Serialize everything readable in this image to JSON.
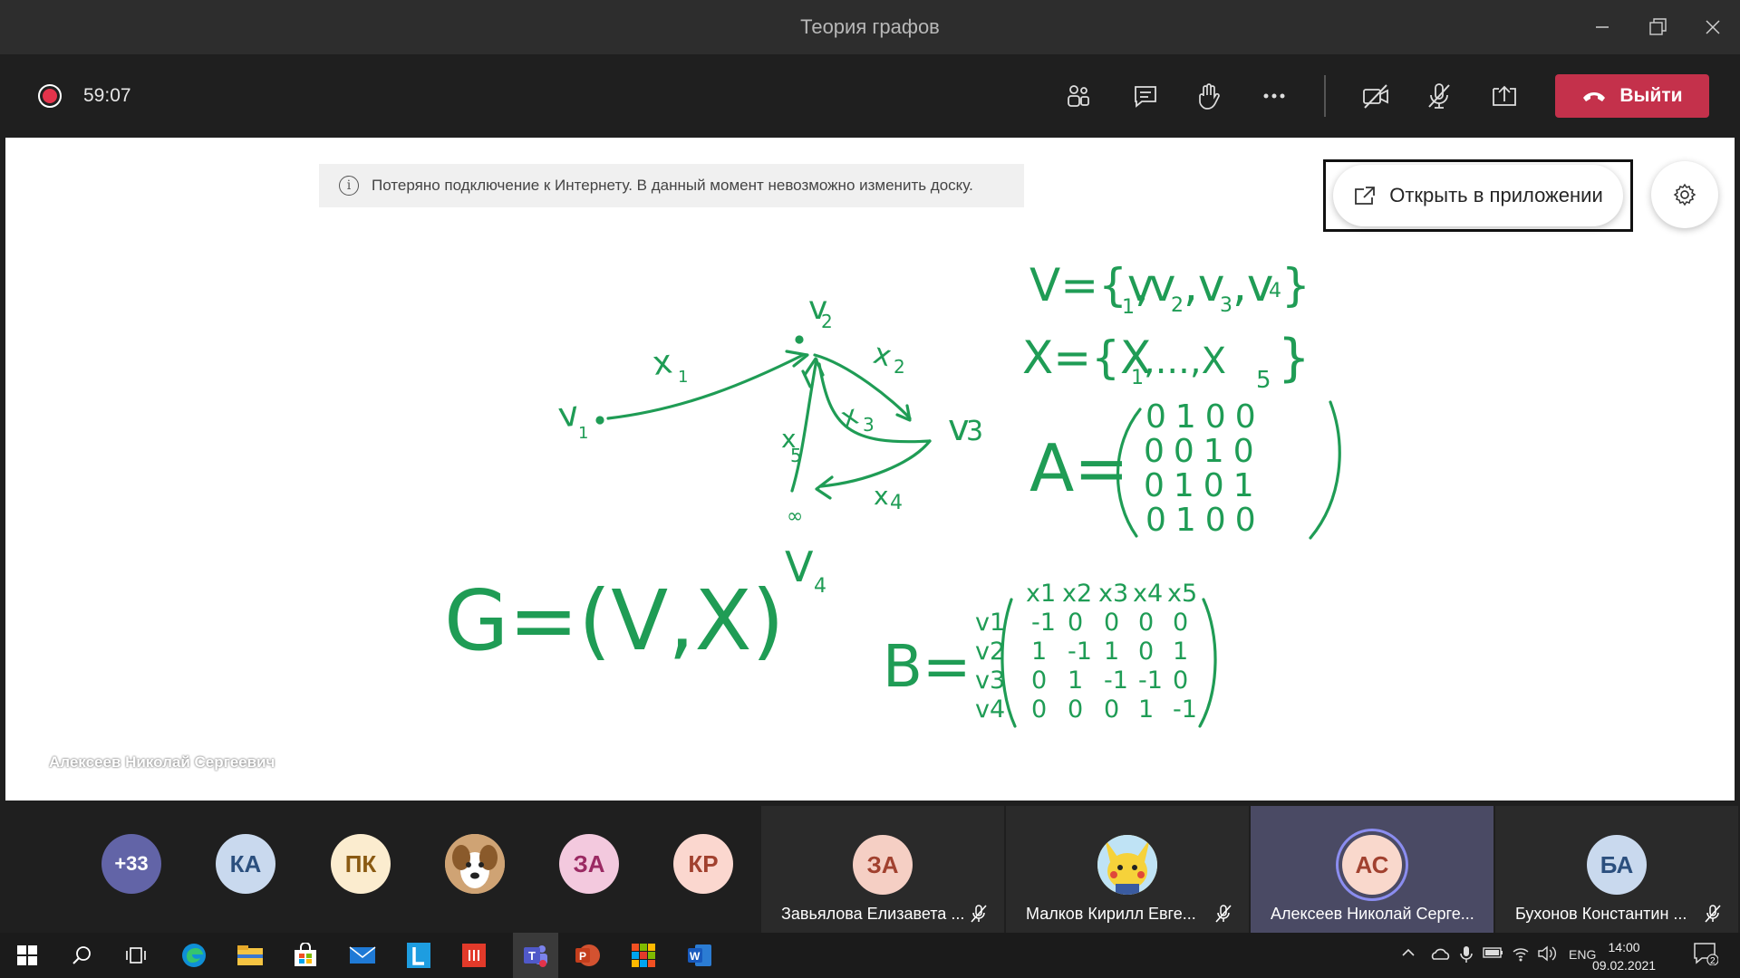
{
  "window": {
    "title": "Теория графов"
  },
  "toolbar": {
    "timer": "59:07",
    "leave_label": "Выйти",
    "buttons": [
      "participants-icon",
      "chat-icon",
      "raise-hand-icon",
      "more-icon",
      "camera-off-icon",
      "mic-off-icon",
      "share-tray-icon"
    ],
    "accent": "#c4314b"
  },
  "whiteboard": {
    "warning": "Потеряно подключение к Интернету. В данный момент невозможно изменить доску.",
    "open_in_app": "Открыть в приложении",
    "presenter": "Алексеев Николай Сергеевич",
    "ink_color": "#1f9c55",
    "matrix_b": {
      "col_headers": [
        "x1",
        "x2",
        "x3",
        "x4",
        "x5"
      ],
      "row_headers": [
        "v1",
        "v2",
        "v3",
        "v4"
      ],
      "rows": [
        [
          "-1",
          "0",
          "0",
          "0",
          "0"
        ],
        [
          "1",
          "-1",
          "1",
          "0",
          "1"
        ],
        [
          "0",
          "1",
          "-1",
          "-1",
          "0"
        ],
        [
          "0",
          "0",
          "0",
          "1",
          "-1"
        ]
      ]
    },
    "matrix_a": {
      "rows": [
        [
          "0",
          "1",
          "0",
          "0"
        ],
        [
          "0",
          "0",
          "1",
          "0"
        ],
        [
          "0",
          "1",
          "0",
          "1"
        ],
        [
          "0",
          "1",
          "0",
          "0"
        ]
      ]
    }
  },
  "participants": {
    "overflow": "+33",
    "small_avatars": [
      {
        "initials": "КА",
        "bg": "#c9d9ee",
        "fg": "#2b4f7e"
      },
      {
        "initials": "ПК",
        "bg": "#fbeccf",
        "fg": "#8a5a12"
      },
      {
        "initials": "",
        "bg": "#d8b48a",
        "fg": "#5a3a1a",
        "icon": "dog-photo"
      },
      {
        "initials": "ЗА",
        "bg": "#f3c9de",
        "fg": "#9b2a63"
      },
      {
        "initials": "КР",
        "bg": "#fbd7cf",
        "fg": "#a1412f"
      }
    ],
    "tiles": [
      {
        "initials": "ЗА",
        "name": "Завьялова Елизавета ...",
        "bg": "#f5cfc4",
        "fg": "#a1412f"
      },
      {
        "initials": "",
        "name": "Малков Кирилл Евге...",
        "bg": "#f3dd6b",
        "fg": "#444",
        "icon": "pikachu-photo"
      },
      {
        "initials": "АС",
        "name": "Алексеев Николай Серге...",
        "bg": "#f9d8cc",
        "fg": "#a1412f",
        "speaking": true
      },
      {
        "initials": "БА",
        "name": "Бухонов Константин ...",
        "bg": "#c9d9ee",
        "fg": "#2b4f7e"
      }
    ]
  },
  "taskbar": {
    "apps": [
      "windows-icon",
      "search-icon",
      "task-view-icon",
      "edge-icon",
      "explorer-icon",
      "store-icon",
      "mail-icon",
      "l-app-icon",
      "red-app-icon",
      "teams-icon",
      "powerpoint-icon",
      "colorful-app-icon",
      "word-icon"
    ],
    "lang": "ENG",
    "time": "14:00",
    "date": "09.02.2021",
    "notifications": "2"
  }
}
